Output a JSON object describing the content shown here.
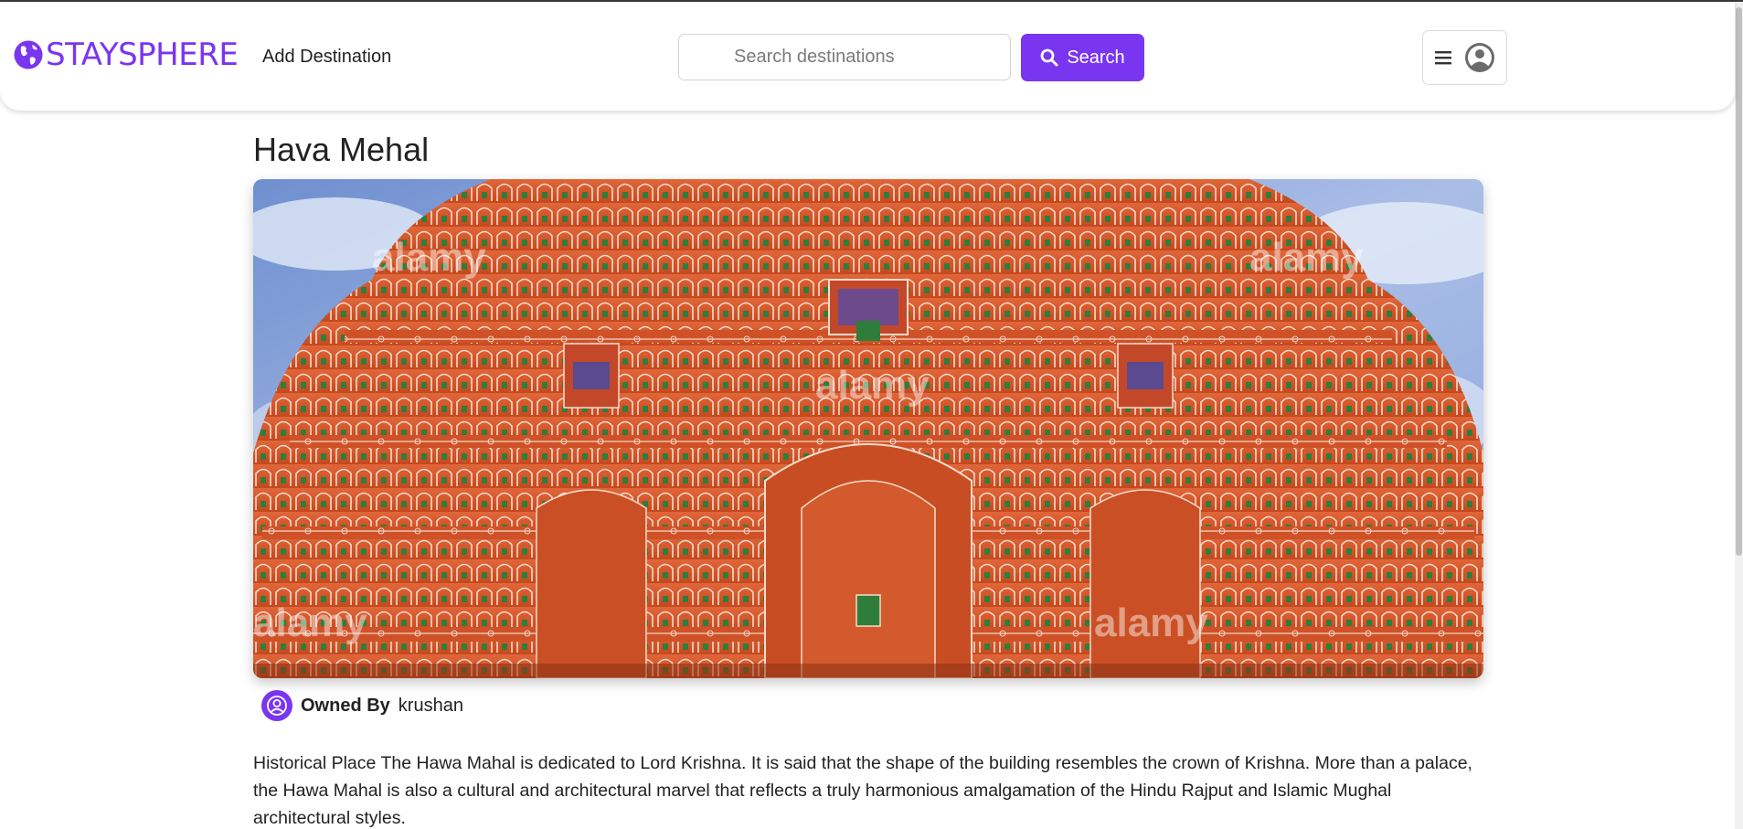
{
  "navbar": {
    "brand": "STAYSPHERE",
    "add_destination": "Add Destination",
    "search": {
      "placeholder": "Search destinations",
      "value": ""
    },
    "search_button": "Search"
  },
  "listing": {
    "title": "Hava Mehal",
    "owner_label": "Owned By",
    "owner_name": "krushan",
    "description": "Historical Place The Hawa Mahal is dedicated to Lord Krishna. It is said that the shape of the building resembles the crown of Krishna. More than a palace, the Hawa Mahal is also a cultural and architectural marvel that reflects a truly harmonious amalgamation of the Hindu Rajput and Islamic Mughal architectural styles.",
    "image_watermark": "alamy"
  },
  "colors": {
    "accent": "#7a35f0",
    "facade": "#d9592a",
    "sky": "#7d9bd6"
  },
  "icons": {
    "brand": "globe-icon",
    "search": "search-icon",
    "menu": "hamburger-icon",
    "user": "user-circle-icon",
    "owner": "user-circle-icon"
  }
}
